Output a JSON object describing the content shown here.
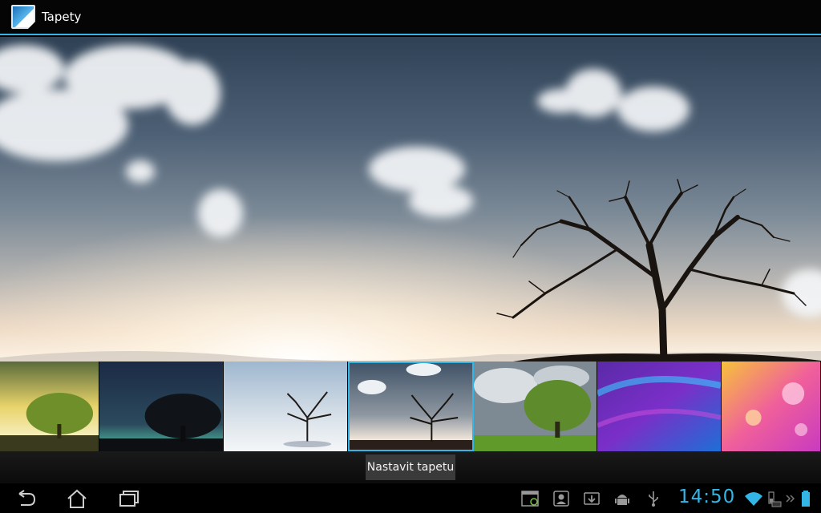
{
  "app": {
    "title": "Tapety",
    "icon": "wallpaper-app-icon"
  },
  "thumbnails": [
    {
      "id": "thumb-1",
      "scene": "green-tree-yellow-sky",
      "selected": false
    },
    {
      "id": "thumb-2",
      "scene": "tree-night-aurora",
      "selected": false
    },
    {
      "id": "thumb-3",
      "scene": "bare-tree-snow",
      "selected": false
    },
    {
      "id": "thumb-4",
      "scene": "bare-tree-sunset",
      "selected": true
    },
    {
      "id": "thumb-5",
      "scene": "green-tree-cloudy",
      "selected": false
    },
    {
      "id": "thumb-6",
      "scene": "purple-waves",
      "selected": false
    },
    {
      "id": "thumb-7",
      "scene": "pink-bokeh",
      "selected": false
    }
  ],
  "actions": {
    "set_wallpaper": "Nastavit tapetu"
  },
  "system_bar": {
    "clock": "14:50",
    "accent": "#33b5e5",
    "nav": [
      "back-icon",
      "home-icon",
      "recent-apps-icon"
    ],
    "notifications": [
      "screenshot-icon",
      "contact-icon",
      "download-icon",
      "android-debug-icon",
      "usb-icon"
    ],
    "status": [
      "wifi-icon",
      "keyboard-battery-icon",
      "expand-icon",
      "battery-icon"
    ]
  }
}
